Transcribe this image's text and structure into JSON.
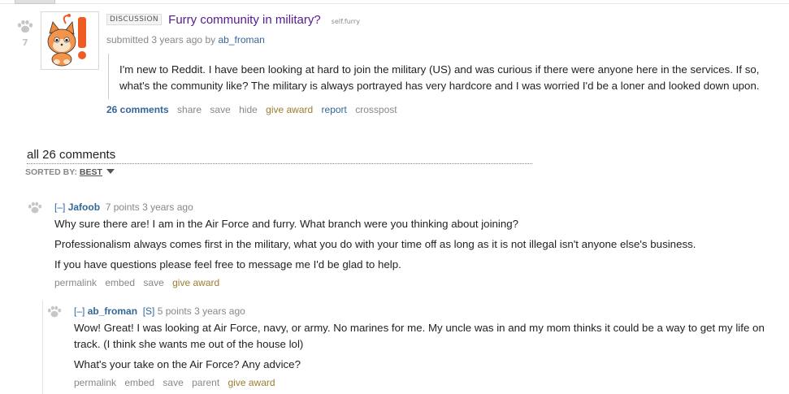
{
  "post": {
    "score": "7",
    "flair": "DISCUSSION",
    "title": "Furry community in military?",
    "domain": "self.furry",
    "submitted_prefix": "submitted",
    "submitted_time": "3 years ago",
    "by_label": "by",
    "author": "ab_froman",
    "selftext": "I'm new to Reddit. I have been looking at hard to join the military (US) and was curious if there were anyone here in the services. If so, what's the community like? The military is always portrayed has very hardcore and I was worried I'd be a loner and looked down upon.",
    "buttons": {
      "comments": "26 comments",
      "share": "share",
      "save": "save",
      "hide": "hide",
      "give_award": "give award",
      "report": "report",
      "crosspost": "crosspost"
    }
  },
  "comments_area": {
    "header": "all 26 comments",
    "sorted_label": "SORTED BY:",
    "sorted_value": "BEST"
  },
  "comments": [
    {
      "toggle": "[–]",
      "author": "Jafoob",
      "meta": "7 points 3 years ago",
      "paragraphs": [
        "Why sure there are! I am in the Air Force and furry. What branch were you thinking about joining?",
        "Professionalism always comes first in the military, what you do with your time off as long as it is not illegal isn't anyone else's business.",
        "If you have questions please feel free to message me I'd be glad to help."
      ],
      "buttons": {
        "permalink": "permalink",
        "embed": "embed",
        "save": "save",
        "give_award": "give award"
      }
    },
    {
      "toggle": "[–]",
      "author": "ab_froman",
      "submitter_tag": "[S]",
      "meta": "5 points 3 years ago",
      "paragraphs": [
        "Wow! Great! I was looking at Air Force, navy, or army. No marines for me. My uncle was in and my mom thinks it could be a way to get my life on track. (I think she wants me out of the house lol)",
        "What's your take on the Air Force? Any advice?"
      ],
      "buttons": {
        "permalink": "permalink",
        "embed": "embed",
        "save": "save",
        "parent": "parent",
        "give_award": "give award"
      }
    }
  ],
  "colors": {
    "link": "#336699",
    "title_visited": "#551a8b",
    "award": "#9a7d2e",
    "muted": "#888888"
  },
  "icons": [
    "paw-upvote-icon",
    "fox-thumbnail-icon",
    "sort-caret-icon"
  ]
}
